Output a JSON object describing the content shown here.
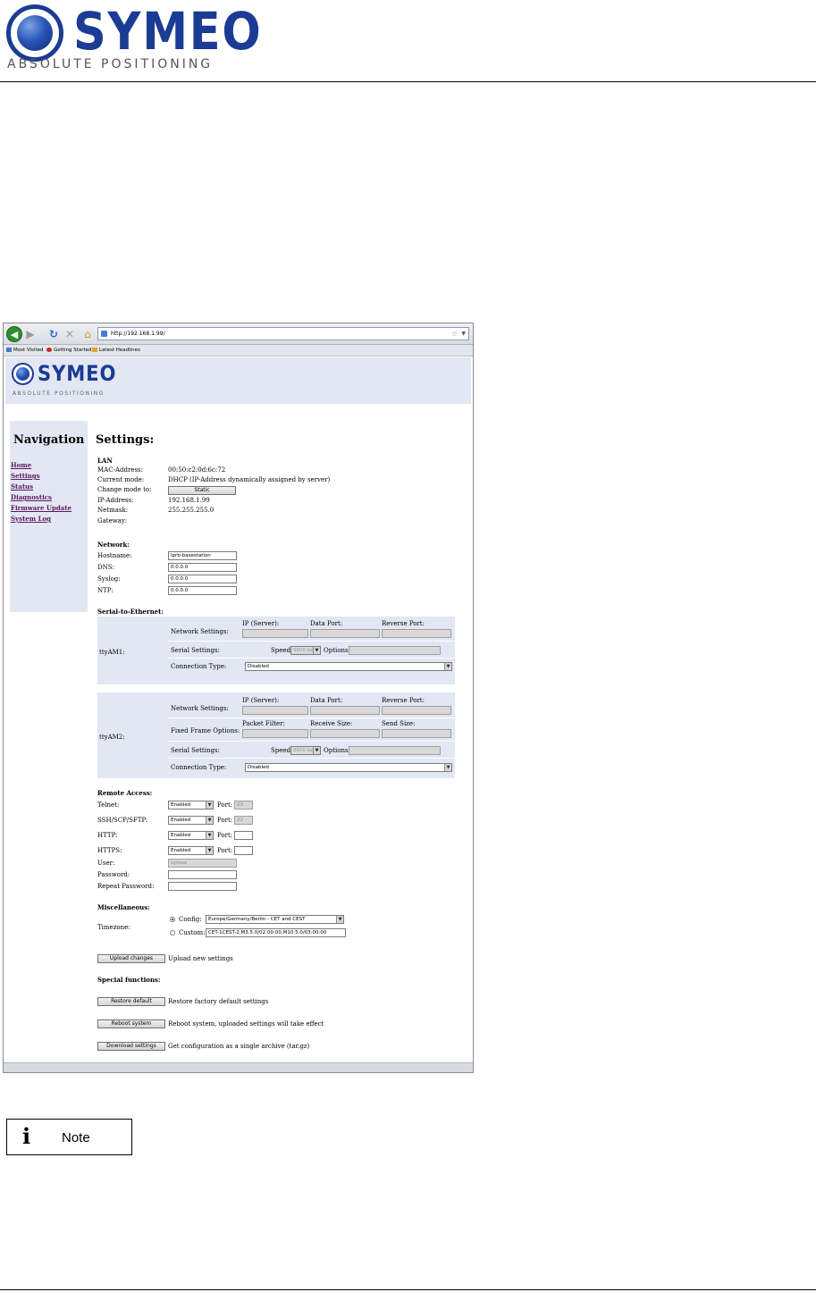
{
  "document": {
    "logo_word": "SYMEO",
    "logo_tagline": "ABSOLUTE POSITIONING",
    "note_icon": "i",
    "note_label": "Note"
  },
  "browser": {
    "url": "http://192.168.1.99/",
    "bookmarks": [
      "Most Visited",
      "Getting Started",
      "Latest Headlines"
    ],
    "icons": [
      "back-icon",
      "forward-icon",
      "reload-icon",
      "stop-icon",
      "home-icon",
      "star-icon"
    ]
  },
  "page": {
    "logo_word": "SYMEO",
    "logo_tagline": "ABSOLUTE POSITIONING",
    "nav": {
      "heading": "Navigation",
      "links": [
        "Home",
        "Settings",
        "Status",
        "Diagnostics",
        "Firmware Update",
        "System Log"
      ]
    },
    "title": "Settings:",
    "lan": {
      "heading": "LAN",
      "mac_label": "MAC-Address:",
      "mac_value": "00:50:c2:0d:6c:72",
      "mode_label": "Current mode:",
      "mode_value": "DHCP (IP-Address dynamically assigned by server)",
      "change_label": "Change mode to:",
      "change_button": "Static",
      "ip_label": "IP-Address:",
      "ip_value": "192.168.1.99",
      "netmask_label": "Netmask:",
      "netmask_value": "255.255.255.0",
      "gateway_label": "Gateway:"
    },
    "network": {
      "heading": "Network:",
      "hostname_label": "Hostname:",
      "hostname_value": "lprb-basestation",
      "dns_label": "DNS:",
      "dns_value": "0.0.0.0",
      "syslog_label": "Syslog:",
      "syslog_value": "0.0.0.0",
      "ntp_label": "NTP:",
      "ntp_value": "0.0.0.0"
    },
    "serial": {
      "heading": "Serial-to-Ethernet:",
      "tty1": {
        "name": "ttyAM1:",
        "net_label": "Network Settings:",
        "ip_label": "IP (Server):",
        "data_label": "Data Port:",
        "reverse_label": "Reverse Port:",
        "serial_label": "Serial Settings:",
        "speed_label": "Speed:",
        "speed_value": "9600 bps",
        "options_label": "Options:",
        "conn_label": "Connection Type:",
        "conn_value": "Disabled"
      },
      "tty2": {
        "name": "ttyAM2:",
        "net_label": "Network Settings:",
        "ip_label": "IP (Server):",
        "data_label": "Data Port:",
        "reverse_label": "Reverse Port:",
        "frame_label": "Fixed Frame Options:",
        "packet_label": "Packet Filter:",
        "receive_label": "Receive Size:",
        "send_label": "Send Size:",
        "serial_label": "Serial Settings:",
        "speed_label": "Speed:",
        "speed_value": "9600 bps",
        "options_label": "Options:",
        "conn_label": "Connection Type:",
        "conn_value": "Disabled"
      }
    },
    "remote": {
      "heading": "Remote Access:",
      "rows": [
        {
          "label": "Telnet:",
          "value": "Enabled",
          "port_label": "Port:",
          "port": "23"
        },
        {
          "label": "SSH/SCP/SFTP:",
          "value": "Enabled",
          "port_label": "Port:",
          "port": "22"
        },
        {
          "label": "HTTP:",
          "value": "Enabled",
          "port_label": "Port:",
          "port": ""
        },
        {
          "label": "HTTPS:",
          "value": "Enabled",
          "port_label": "Port:",
          "port": ""
        }
      ],
      "user_label": "User:",
      "user_value": "symeo",
      "password_label": "Password:",
      "repeat_label": "Repeat Password:"
    },
    "misc": {
      "heading": "Miscellaneous:",
      "timezone_label": "Timezone:",
      "config_label": "Config:",
      "config_value": "Europe/Germany/Berlin - CET and CEST",
      "custom_label": "Custom:",
      "custom_value": "CET-1CEST-2,M3.5.0/02:00:00,M10.5.0/03:00:00"
    },
    "upload_button": "Upload changes",
    "upload_text": "Upload new settings",
    "special": {
      "heading": "Special functions:",
      "restore_button": "Restore default",
      "restore_text": "Restore factory default settings",
      "reboot_button": "Reboot system",
      "reboot_text": "Reboot system, uploaded settings will take effect",
      "download_button": "Download settings",
      "download_text": "Get configuration as a single archive (tar.gz)"
    }
  }
}
